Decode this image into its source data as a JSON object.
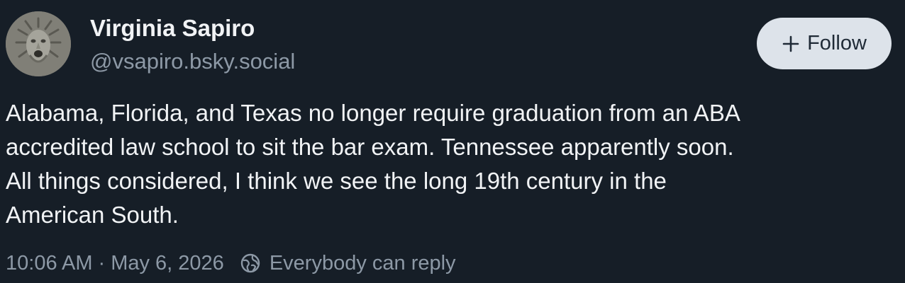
{
  "author": {
    "display_name": "Virginia Sapiro",
    "handle": "@vsapiro.bsky.social",
    "avatar_icon": "carved-stone-face-avatar"
  },
  "follow_button": {
    "label": "Follow",
    "icon": "plus-icon"
  },
  "post": {
    "text_lines": [
      "Alabama, Florida, and Texas no longer require graduation from an ABA",
      "accredited law school to sit the bar exam. Tennessee apparently soon.",
      "All things considered, I think we see the long 19th century in the",
      "American South."
    ]
  },
  "meta": {
    "time": "10:06 AM",
    "separator": "·",
    "date": "May 6, 2026",
    "reply_icon": "globe-icon",
    "reply_setting": "Everybody can reply"
  },
  "colors": {
    "background": "#161e27",
    "text_primary": "#f1f3f5",
    "text_secondary": "#8d99a6",
    "follow_button_bg": "#dde3ea",
    "follow_button_text": "#1f2a36"
  }
}
